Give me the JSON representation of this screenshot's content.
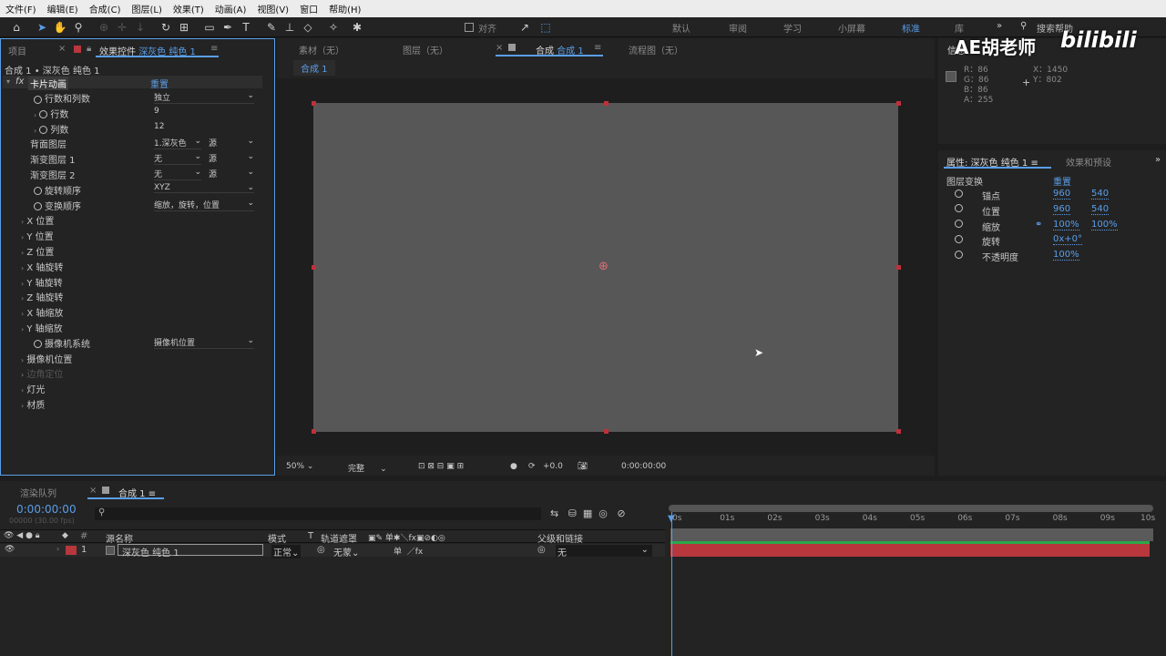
{
  "menu": [
    "文件(F)",
    "编辑(E)",
    "合成(C)",
    "图层(L)",
    "效果(T)",
    "动画(A)",
    "视图(V)",
    "窗口",
    "帮助(H)"
  ],
  "toolbar": {
    "align_label": "对齐",
    "workspaces": [
      "默认",
      "审阅",
      "学习",
      "小屏幕",
      "标准",
      "库"
    ],
    "active_workspace": "标准",
    "more": "»",
    "search_placeholder": "搜索帮助"
  },
  "watermark": "AE胡老师",
  "left_panel": {
    "tab_project": "项目",
    "tab_effects_prefix": "效果控件",
    "tab_effects_layer": "深灰色 纯色 1",
    "breadcrumb": "合成 1 • 深灰色 纯色 1",
    "effect_name": "卡片动画",
    "reset": "重置",
    "props": [
      {
        "label": "行数和列数",
        "value": "独立",
        "stopwatch": true,
        "arrow": false
      },
      {
        "label": "行数",
        "value": "9",
        "stopwatch": true,
        "arrow": true
      },
      {
        "label": "列数",
        "value": "12",
        "stopwatch": true,
        "arrow": true
      },
      {
        "label": "背面图层",
        "value": "1.深灰色",
        "value2": "源",
        "stopwatch": false,
        "arrow": false
      },
      {
        "label": "渐变图层 1",
        "value": "无",
        "value2": "源",
        "stopwatch": false,
        "arrow": false
      },
      {
        "label": "渐变图层 2",
        "value": "无",
        "value2": "源",
        "stopwatch": false,
        "arrow": false
      },
      {
        "label": "旋转顺序",
        "value": "XYZ",
        "stopwatch": true,
        "arrow": false
      },
      {
        "label": "变换顺序",
        "value": "缩放，旋转，位置",
        "stopwatch": true,
        "arrow": false
      },
      {
        "label": "X 位置",
        "arrow": true
      },
      {
        "label": "Y 位置",
        "arrow": true
      },
      {
        "label": "Z 位置",
        "arrow": true
      },
      {
        "label": "X 轴旋转",
        "arrow": true
      },
      {
        "label": "Y 轴旋转",
        "arrow": true
      },
      {
        "label": "Z 轴旋转",
        "arrow": true
      },
      {
        "label": "X 轴缩放",
        "arrow": true
      },
      {
        "label": "Y 轴缩放",
        "arrow": true
      },
      {
        "label": "摄像机系统",
        "value": "摄像机位置",
        "stopwatch": true,
        "arrow": false
      },
      {
        "label": "摄像机位置",
        "arrow": true
      },
      {
        "label": "边角定位",
        "arrow": true,
        "disabled": true
      },
      {
        "label": "灯光",
        "arrow": true
      },
      {
        "label": "材质",
        "arrow": true
      }
    ]
  },
  "center": {
    "tab_footage": "素材（无）",
    "tab_layer": "图层（无）",
    "tab_comp_prefix": "合成",
    "tab_comp_name": "合成 1",
    "tab_flowchart": "流程图（无）",
    "comp_subtab": "合成 1",
    "zoom": "50%",
    "resolution": "完整",
    "exposure": "+0.0",
    "timecode": "0:00:00:00"
  },
  "info": {
    "tab": "信息",
    "r": "R：86",
    "g": "G：86",
    "b": "B：86",
    "a": "A：255",
    "x": "X：1450",
    "y": "Y：802"
  },
  "properties": {
    "tab_prefix": "属性:",
    "tab_layer": "深灰色 纯色 1",
    "tab_effects": "效果和预设",
    "section": "图层变换",
    "reset": "重置",
    "rows": [
      {
        "label": "锚点",
        "v1": "960",
        "v2": "540"
      },
      {
        "label": "位置",
        "v1": "960",
        "v2": "540"
      },
      {
        "label": "缩放",
        "v1": "100%",
        "v2": "100%"
      },
      {
        "label": "旋转",
        "v1": "0x+0°",
        "v2": ""
      },
      {
        "label": "不透明度",
        "v1": "100%",
        "v2": ""
      }
    ]
  },
  "timeline": {
    "tab_render": "渲染队列",
    "tab_comp": "合成 1",
    "timecode": "0:00:00:00",
    "frame": "00000 (30.00 fps)",
    "col_num": "#",
    "col_source": "源名称",
    "col_mode": "模式",
    "col_t": "T",
    "col_matte": "轨道遮罩",
    "col_parent": "父级和链接",
    "layer": {
      "num": "1",
      "name": "深灰色 纯色 1",
      "mode": "正常",
      "matte": "无蒙",
      "parent": "无"
    },
    "ruler": [
      "0s",
      "01s",
      "02s",
      "03s",
      "04s",
      "05s",
      "06s",
      "07s",
      "08s",
      "09s",
      "10s"
    ]
  },
  "colors": {
    "accent": "#5a9ee8",
    "layer_red": "#b7373c",
    "canvas": "#575757"
  }
}
